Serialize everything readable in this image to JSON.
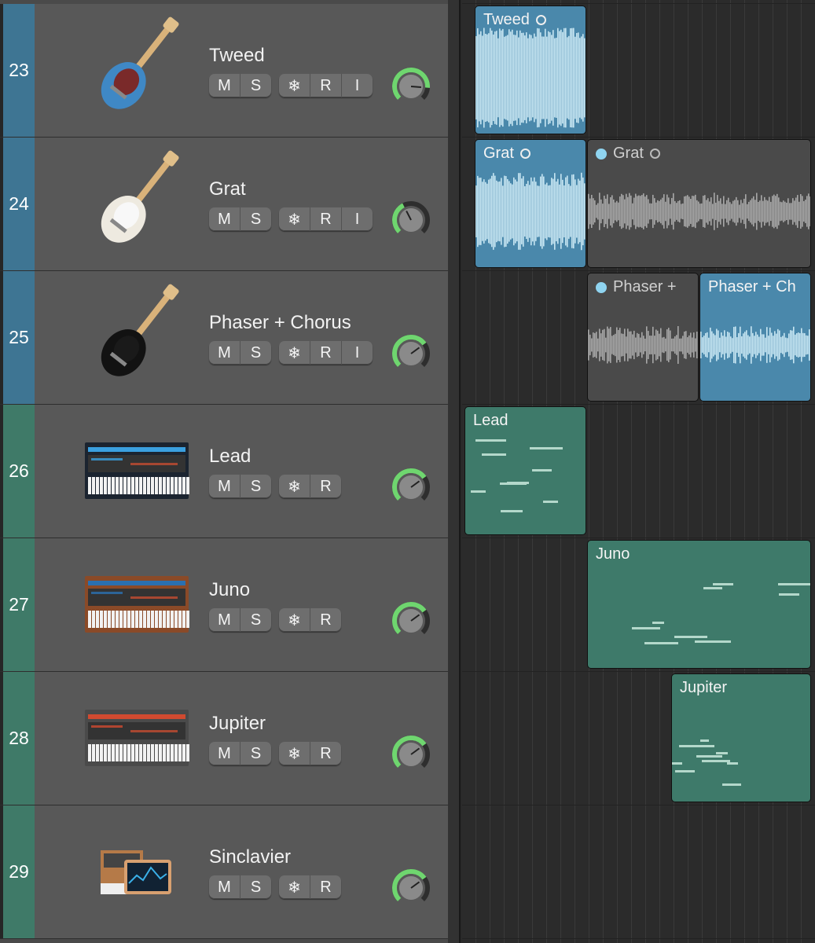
{
  "tracks": [
    {
      "number": "23",
      "name": "Tweed",
      "kind": "audio",
      "instrument_icon": "telecaster-guitar-icon",
      "buttons": [
        "M",
        "S",
        "❄",
        "R",
        "I"
      ],
      "volume": 0.85
    },
    {
      "number": "24",
      "name": "Grat",
      "kind": "audio",
      "instrument_icon": "stratocaster-guitar-icon",
      "buttons": [
        "M",
        "S",
        "❄",
        "R",
        "I"
      ],
      "volume": 0.4
    },
    {
      "number": "25",
      "name": "Phaser +  Chorus",
      "kind": "audio",
      "instrument_icon": "sg-guitar-icon",
      "buttons": [
        "M",
        "S",
        "❄",
        "R",
        "I"
      ],
      "volume": 0.7
    },
    {
      "number": "26",
      "name": "Lead",
      "kind": "midi",
      "instrument_icon": "synth-plugin-icon",
      "buttons": [
        "M",
        "S",
        "❄",
        "R"
      ],
      "volume": 0.7
    },
    {
      "number": "27",
      "name": "Juno",
      "kind": "midi",
      "instrument_icon": "juno-synth-icon",
      "buttons": [
        "M",
        "S",
        "❄",
        "R"
      ],
      "volume": 0.7
    },
    {
      "number": "28",
      "name": "Jupiter",
      "kind": "midi",
      "instrument_icon": "jupiter-synth-icon",
      "buttons": [
        "M",
        "S",
        "❄",
        "R"
      ],
      "volume": 0.7
    },
    {
      "number": "29",
      "name": "Sinclavier",
      "kind": "midi",
      "instrument_icon": "sinclavier-synth-icon",
      "buttons": [
        "M",
        "S",
        "❄",
        "R"
      ],
      "volume": 0.7
    }
  ],
  "regions": [
    {
      "track": 0,
      "label": "Tweed",
      "type": "audio-sel",
      "loop": true,
      "dot": false
    },
    {
      "track": 1,
      "label": "Grat",
      "type": "audio-sel",
      "loop": true,
      "dot": false
    },
    {
      "track": 1,
      "label": "Grat",
      "type": "audio-un",
      "loop": true,
      "dot": true
    },
    {
      "track": 2,
      "label": "Phaser +",
      "type": "audio-un",
      "loop": false,
      "dot": true
    },
    {
      "track": 2,
      "label": "Phaser +  Ch",
      "type": "audio-sel",
      "loop": false,
      "dot": false
    },
    {
      "track": 3,
      "label": "Lead",
      "type": "midi",
      "loop": false,
      "dot": false
    },
    {
      "track": 4,
      "label": "Juno",
      "type": "midi",
      "loop": false,
      "dot": false
    },
    {
      "track": 5,
      "label": "Jupiter",
      "type": "midi",
      "loop": false,
      "dot": false
    }
  ],
  "colors": {
    "audio_header": "#3e7593",
    "midi_header": "#3f7a68",
    "knob_ring": "#6fd66f",
    "audio_region": "#4a88ab",
    "midi_region": "#3e7a6a"
  }
}
